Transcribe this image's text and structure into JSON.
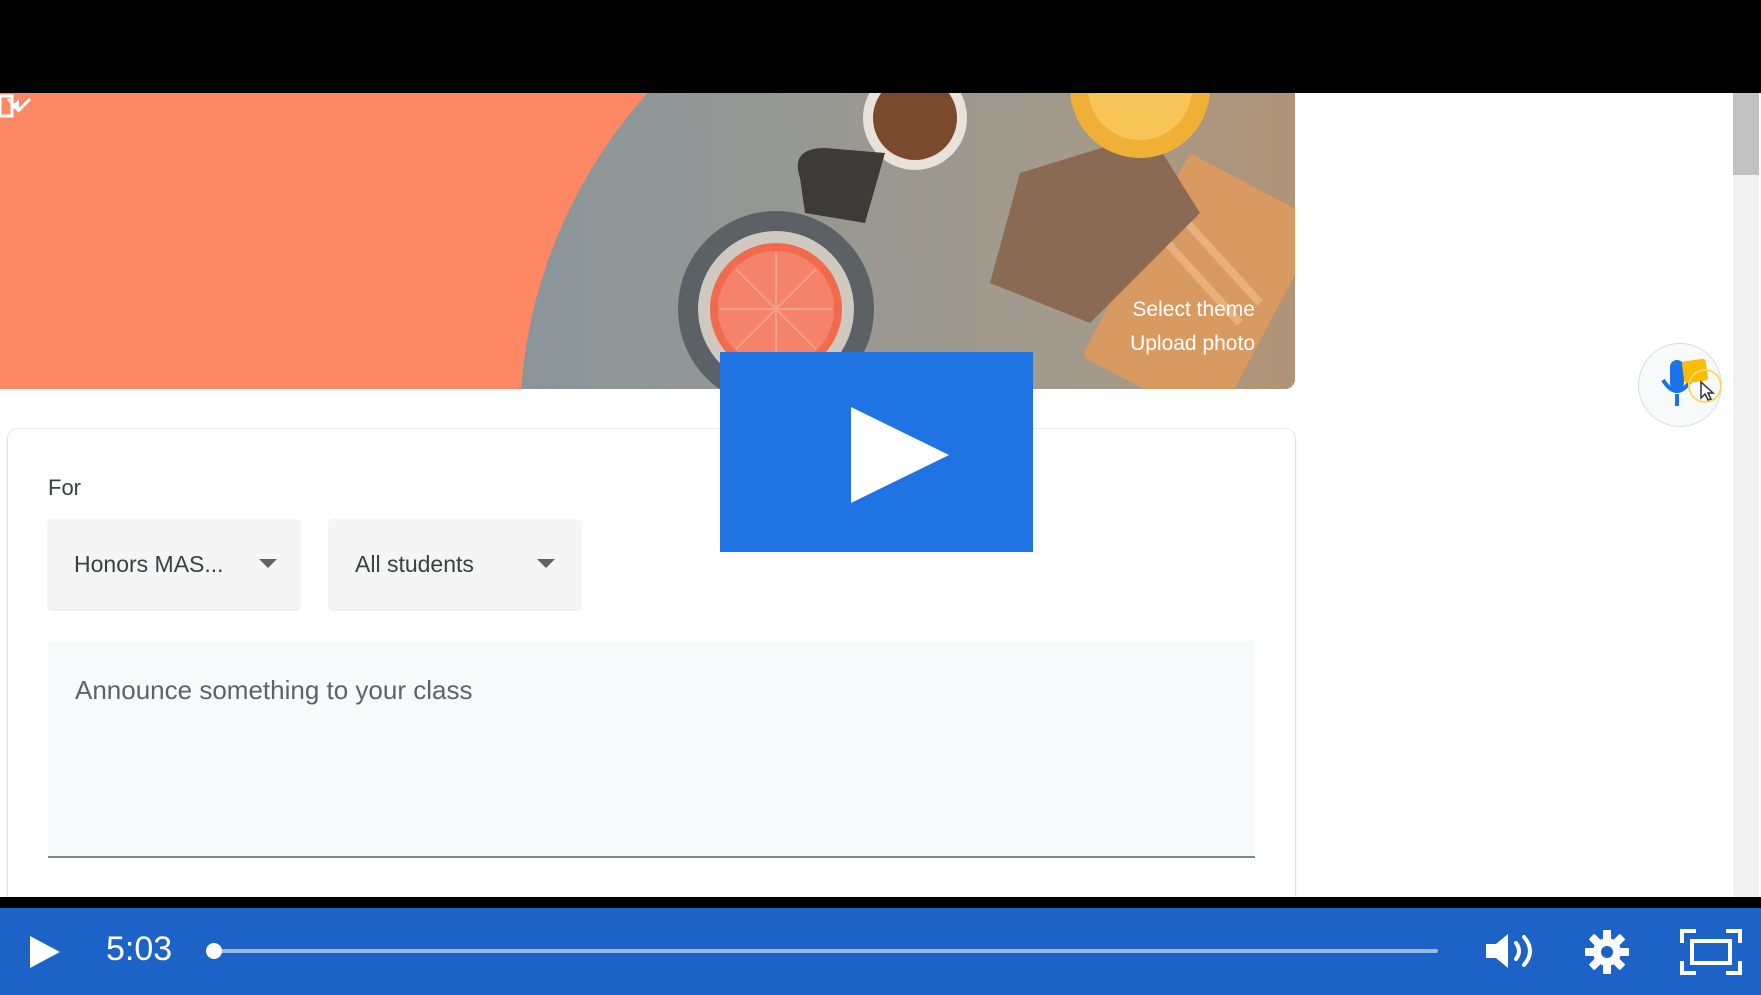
{
  "banner": {
    "select_theme": "Select theme",
    "upload_photo": "Upload photo",
    "color": "#ff8864"
  },
  "post_form": {
    "for_label": "For",
    "class_select": {
      "value": "Honors MAS..."
    },
    "students_select": {
      "value": "All students"
    },
    "announce_placeholder": "Announce something to your class"
  },
  "player": {
    "time": "5:03",
    "progress_fraction": 0.002,
    "accent": "#1d63c7",
    "play_overlay_color": "#1f73e2"
  },
  "icons": [
    "video-camera-icon",
    "chevron-down-icon",
    "microphone-icon",
    "play-icon",
    "volume-icon",
    "settings-gear-icon",
    "fullscreen-icon"
  ]
}
